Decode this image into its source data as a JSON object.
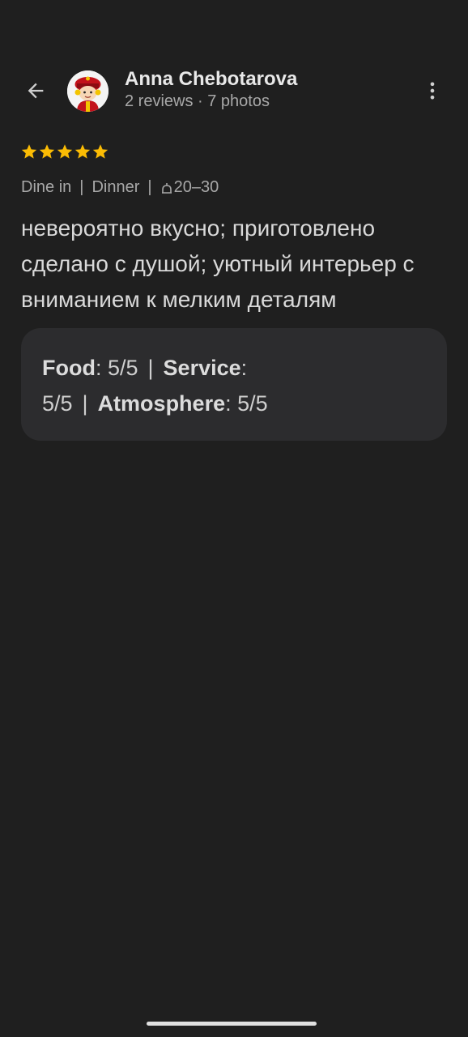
{
  "reviewer": {
    "name": "Anna Chebotarova",
    "meta": "2 reviews · 7 photos"
  },
  "rating": {
    "stars": 5,
    "max": 5,
    "color": "#fbbc04"
  },
  "tags": {
    "service_type": "Dine in",
    "meal": "Dinner",
    "price": "20–30"
  },
  "review_text": "невероятно вкусно; приготовлено сделано с душой; уютный интерьер с вниманием к мелким деталям",
  "ratings": {
    "food_label": "Food",
    "food_value": ": 5/5",
    "service_label": "Service",
    "service_value": "5/5",
    "atmosphere_label": "Atmosphere",
    "atmosphere_value": ": 5/5"
  },
  "icons": {
    "back": "arrow-back-icon",
    "more": "more-vert-icon",
    "price": "price-icon"
  },
  "colors": {
    "background": "#1f1f1f",
    "card": "#2c2c2e",
    "star": "#fbbc04"
  }
}
